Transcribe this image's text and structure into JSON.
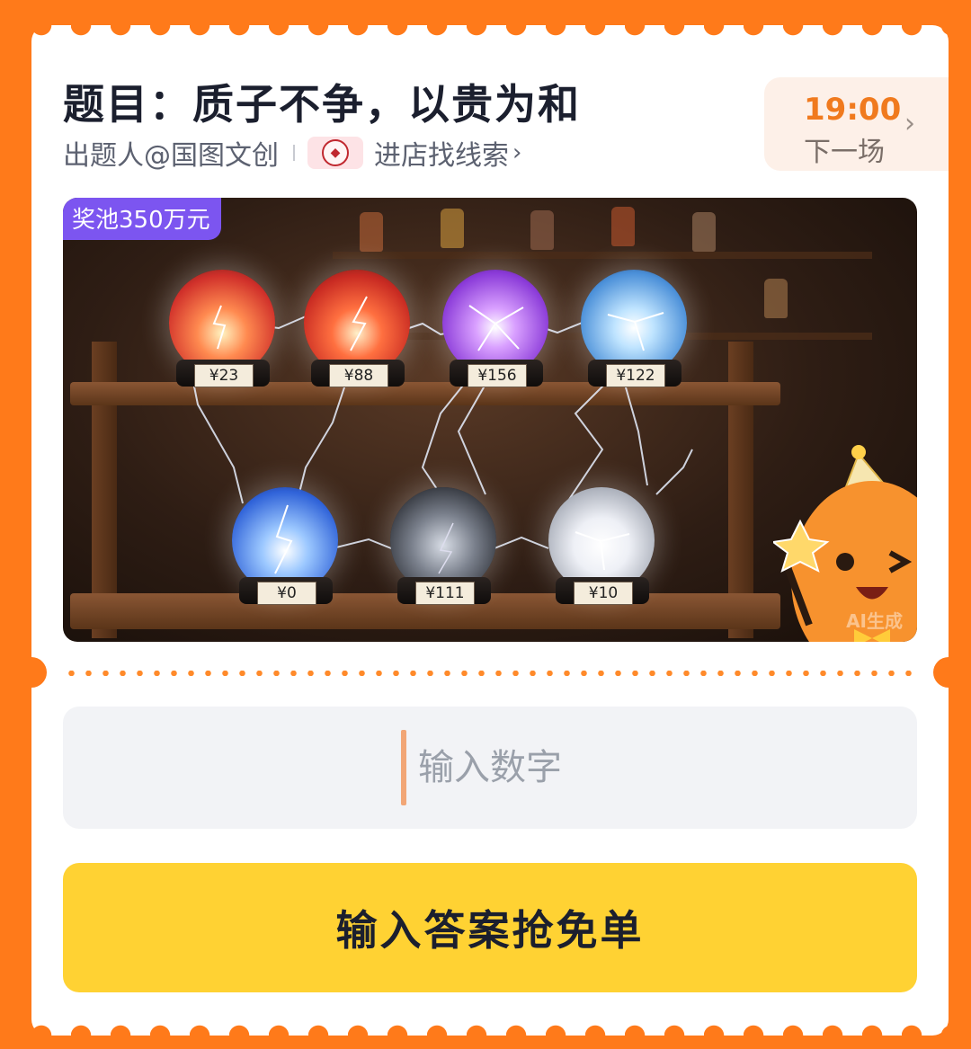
{
  "header": {
    "title": "题目：质子不争，以贵为和",
    "setter": "出题人@国图文创",
    "shop_link": "进店找线索",
    "shop_chevron": "›"
  },
  "next_session": {
    "time": "19:00",
    "label": "下一场",
    "chevron": "›"
  },
  "banner": {
    "prize_pool": "奖池350万元",
    "ai_mark": "AI生成",
    "orbs": [
      {
        "price": "¥23",
        "color": "#ff6a4a"
      },
      {
        "price": "¥88",
        "color": "#ff4d3a"
      },
      {
        "price": "¥156",
        "color": "#b66bff"
      },
      {
        "price": "¥122",
        "color": "#6ab8ff"
      },
      {
        "price": "¥0",
        "color": "#4a8cff"
      },
      {
        "price": "¥111",
        "color": "#9aa0a8"
      },
      {
        "price": "¥10",
        "color": "#e6e8ee"
      }
    ]
  },
  "answer": {
    "placeholder": "输入数字",
    "value": ""
  },
  "submit_label": "输入答案抢免单",
  "colors": {
    "page_bg": "#ff7a1a",
    "accent_orange": "#f07a1e",
    "pool_badge": "#7c55f0",
    "button_yellow": "#ffd233"
  }
}
